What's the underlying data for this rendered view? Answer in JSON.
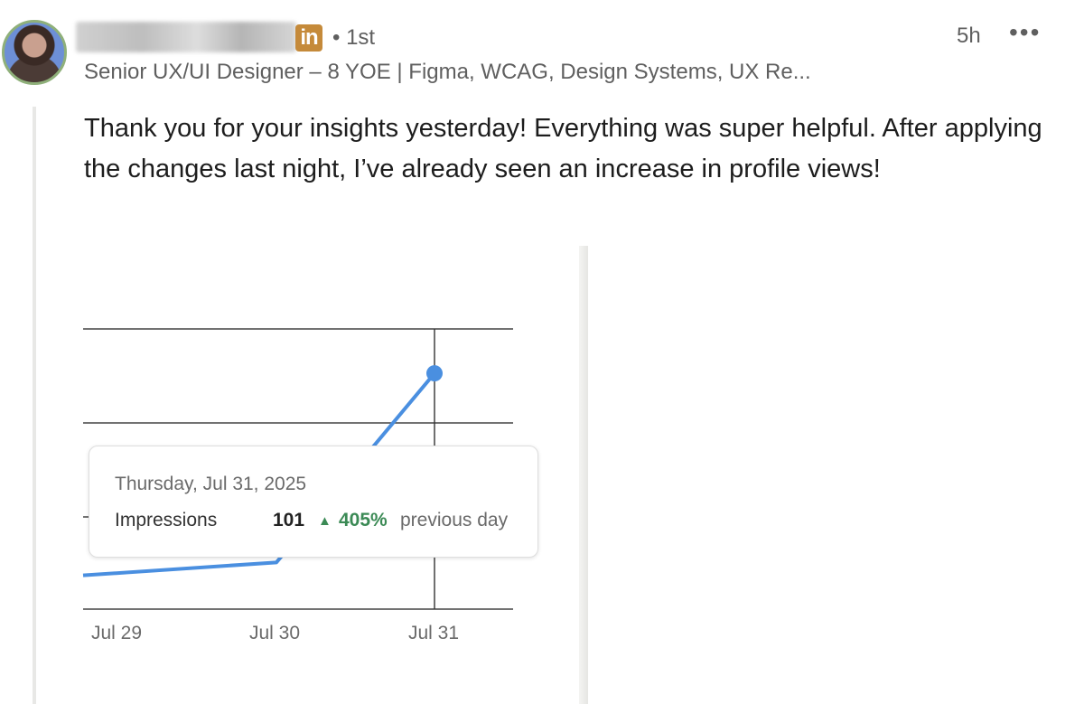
{
  "post": {
    "author_name": "",
    "degree": "• 1st",
    "time_ago": "5h",
    "more_label": "•••",
    "headline": "Senior UX/UI Designer – 8 YOE | Figma, WCAG, Design Systems, UX Re...",
    "body": "Thank you for your insights yesterday! Everything was super helpful. After applying the changes last night, I’ve already seen an increase in profile views!"
  },
  "badge": {
    "label": "in",
    "color": "#c58a3a"
  },
  "icons": {
    "avatar": "profile-photo",
    "more": "more-horizontal-icon",
    "network": "linkedin-badge-icon"
  },
  "tooltip": {
    "date": "Thursday, Jul 31, 2025",
    "label": "Impressions",
    "value": "101",
    "arrow": "▲",
    "change": "405%",
    "suffix": "previous day",
    "positive_color": "#3b8a55"
  },
  "chart_data": {
    "type": "line",
    "categories": [
      "Jul 29",
      "Jul 30",
      "Jul 31"
    ],
    "series": [
      {
        "values": [
          16,
          20,
          101
        ],
        "color": "#4a8fe0"
      }
    ],
    "ylim": [
      0,
      120
    ],
    "grid": true,
    "title": "",
    "xlabel": "",
    "ylabel": ""
  }
}
